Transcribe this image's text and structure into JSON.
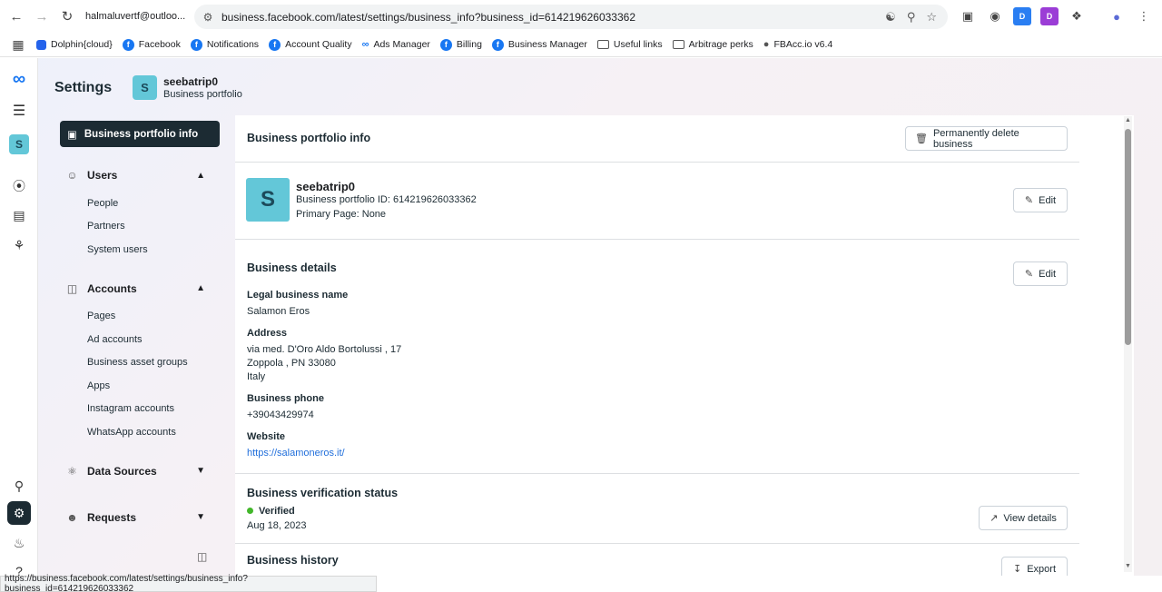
{
  "browser": {
    "profile_email": "halmaluvertf@outloo...",
    "url": "business.facebook.com/latest/settings/business_info?business_id=614219626033362",
    "bookmarks": [
      {
        "label": "Dolphin{cloud}",
        "kind": "dolphin"
      },
      {
        "label": "Facebook",
        "kind": "fb"
      },
      {
        "label": "Notifications",
        "kind": "fb"
      },
      {
        "label": "Account Quality",
        "kind": "fb"
      },
      {
        "label": "Ads Manager",
        "kind": "meta"
      },
      {
        "label": "Billing",
        "kind": "fb"
      },
      {
        "label": "Business Manager",
        "kind": "fb"
      },
      {
        "label": "Useful links",
        "kind": "folder"
      },
      {
        "label": "Arbitrage perks",
        "kind": "folder"
      },
      {
        "label": "FBAcc.io v6.4",
        "kind": "globe"
      }
    ],
    "status_url": "https://business.facebook.com/latest/settings/business_info?business_id=614219626033362"
  },
  "header": {
    "title": "Settings",
    "portfolio_initial": "S",
    "portfolio_name": "seebatrip0",
    "portfolio_type": "Business portfolio"
  },
  "rail": {
    "portfolio_initial": "S"
  },
  "subnav": {
    "active": "Business portfolio info",
    "groups": {
      "users": {
        "label": "Users",
        "items": [
          "People",
          "Partners",
          "System users"
        ]
      },
      "accounts": {
        "label": "Accounts",
        "items": [
          "Pages",
          "Ad accounts",
          "Business asset groups",
          "Apps",
          "Instagram accounts",
          "WhatsApp accounts"
        ]
      },
      "data_sources": {
        "label": "Data Sources"
      },
      "requests": {
        "label": "Requests"
      }
    }
  },
  "main": {
    "title": "Business portfolio info",
    "delete_button": "Permanently delete business",
    "profile": {
      "initial": "S",
      "name": "seebatrip0",
      "portfolio_id": "Business portfolio ID: 614219626033362",
      "primary_page": "Primary Page: None",
      "edit_label": "Edit"
    },
    "details": {
      "title": "Business details",
      "edit_label": "Edit",
      "legal_name_label": "Legal business name",
      "legal_name": "Salamon Eros",
      "address_label": "Address",
      "address_line1": "via med. D'Oro Aldo Bortolussi , 17",
      "address_line2": "Zoppola , PN 33080",
      "address_line3": "Italy",
      "phone_label": "Business phone",
      "phone": "+39043429974",
      "website_label": "Website",
      "website": "https://salamoneros.it/"
    },
    "verification": {
      "title": "Business verification status",
      "status": "Verified",
      "date": "Aug 18, 2023",
      "view_details": "View details"
    },
    "history": {
      "title": "Business history",
      "export": "Export"
    }
  }
}
